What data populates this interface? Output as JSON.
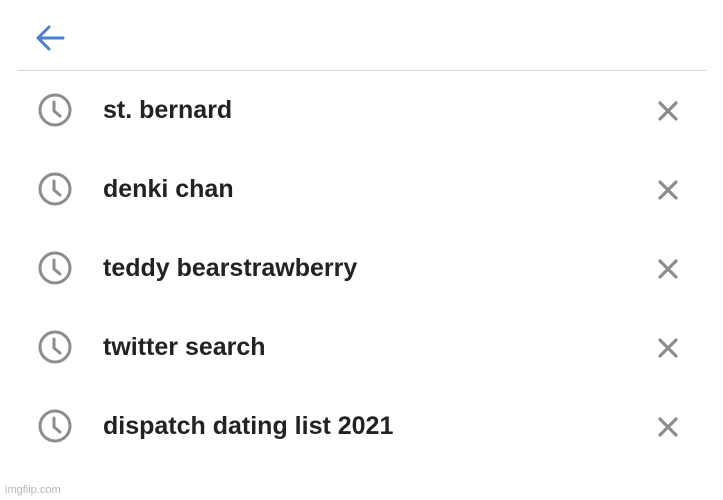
{
  "history": [
    {
      "text": "st. bernard"
    },
    {
      "text": "denki chan"
    },
    {
      "text": "teddy bearstrawberry"
    },
    {
      "text": "twitter search"
    },
    {
      "text": "dispatch dating list 2021"
    }
  ],
  "icons": {
    "back": "arrow-left-icon",
    "history": "clock-icon",
    "remove": "close-icon"
  },
  "colors": {
    "accent": "#4a7fd4",
    "icon_gray": "#8c8c8c",
    "text": "#222222"
  },
  "watermark": "imgflip.com"
}
